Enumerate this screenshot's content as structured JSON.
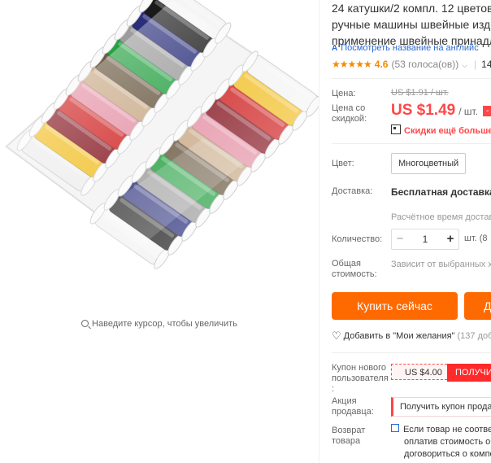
{
  "image": {
    "zoom_hint": "Наведите курсор, чтобы увеличить",
    "thread_colors": [
      "#eeeeee",
      "#f2c230",
      "#d12a2a",
      "#8a1f2a",
      "#e594a8",
      "#c9aa88",
      "#6b5a43",
      "#27a043",
      "#9c9c9c",
      "#2a2f7a",
      "#1a1a1a",
      "#f5f5f5"
    ]
  },
  "product": {
    "title_line1": "24 катушки/2 компл. 12 цветов П",
    "title_line2": "ручные машины швейные изде.",
    "title_line3": "применение швейные принадле",
    "translate_link": "Посмотреть название на английс",
    "translate_icon": "translate-icon",
    "rating_stars": "★★★★★",
    "rating_value": "4.6",
    "votes": "(53 голоса(ов))",
    "orders": "14"
  },
  "price": {
    "label_price": "Цена:",
    "old_price": "US $1.91 / шт.",
    "label_discount_line1": "Цена со",
    "label_discount_line2": "скидкой:",
    "new_price": "US $1.49",
    "unit": "/ шт.",
    "discount_badge": "-",
    "more_discount": "Скидки ещё больше в"
  },
  "color": {
    "label": "Цвет:",
    "value": "Многоцветный"
  },
  "shipping": {
    "label": "Доставка:",
    "value": "Бесплатная доставка в",
    "estimate": "Расчётное время достав"
  },
  "quantity": {
    "label": "Количество:",
    "value": "1",
    "minus": "−",
    "plus": "+",
    "unit": "шт. (8"
  },
  "total": {
    "label_line1": "Общая",
    "label_line2": "стоимость:",
    "value": "Зависит от выбранных ха"
  },
  "actions": {
    "buy_now": "Купить сейчас",
    "add_to_cart": "Д",
    "wishlist": "Добавить в \"Мои желания\"",
    "wishlist_count": "(137 доб"
  },
  "coupon": {
    "label_line1": "Купон нового",
    "label_line2": "пользователя",
    "label_line3": ":",
    "value": "US $4.00",
    "get": "ПОЛУЧИ"
  },
  "promo": {
    "label_line1": "Акция",
    "label_line2": "продавца:",
    "value": "Получить купон прода"
  },
  "returns": {
    "label_line1": "Возврат",
    "label_line2": "товара",
    "line1": "Если товар не соответ",
    "line2": "оплатив стоимость об",
    "line3": "договориться о компе"
  }
}
